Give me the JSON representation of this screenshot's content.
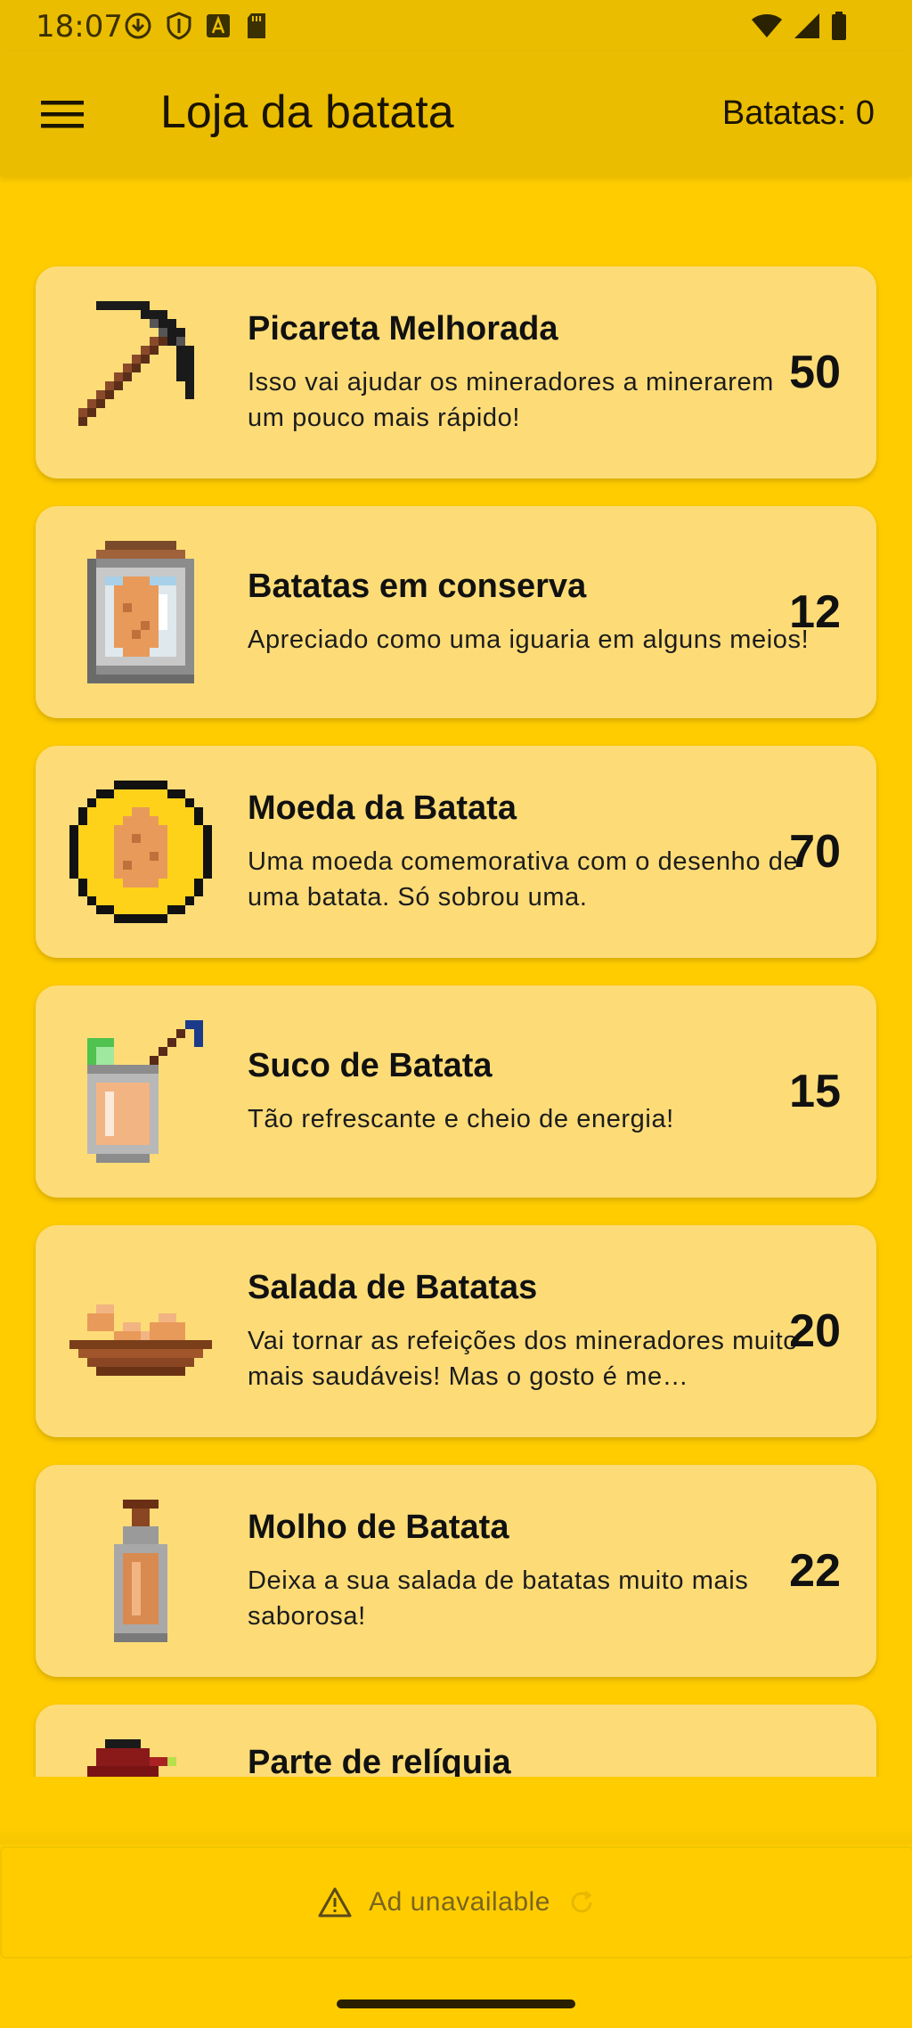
{
  "status_bar": {
    "time": "18:07",
    "left_icons": [
      "download-circle-icon",
      "shield-icon",
      "font-a-icon",
      "sd-card-icon"
    ],
    "right_icons": [
      "wifi-icon",
      "cellular-signal-icon",
      "battery-icon"
    ]
  },
  "app_bar": {
    "title": "Loja da batata",
    "menu_icon": "hamburger-menu-icon",
    "counter": "Batatas: 0"
  },
  "items": [
    {
      "icon": "pickaxe-icon",
      "title": "Picareta Melhorada",
      "description": "Isso vai ajudar os mineradores a minerarem um pouco mais rápido!",
      "price": "50"
    },
    {
      "icon": "potato-jar-icon",
      "title": "Batatas em conserva",
      "description": "Apreciado como uma iguaria em alguns meios!",
      "price": "12"
    },
    {
      "icon": "potato-coin-icon",
      "title": "Moeda da Batata",
      "description": "Uma moeda comemorativa com o desenho de uma batata. Só sobrou uma.",
      "price": "70"
    },
    {
      "icon": "potato-juice-icon",
      "title": "Suco de Batata",
      "description": "Tão refrescante e cheio de energia!",
      "price": "15"
    },
    {
      "icon": "potato-salad-icon",
      "title": "Salada de Batatas",
      "description": "Vai tornar as refeições dos mineradores muito mais saudáveis! Mas o gosto é me…",
      "price": "20"
    },
    {
      "icon": "potato-sauce-bottle-icon",
      "title": "Molho de Batata",
      "description": "Deixa a sua salada de batatas muito mais saborosa!",
      "price": "22"
    },
    {
      "icon": "relic-part-icon",
      "title": "Parte de relíquia",
      "description": "",
      "price": ""
    }
  ],
  "ad_banner": {
    "icon": "warning-icon",
    "text": "Ad unavailable",
    "reload_icon": "refresh-icon"
  },
  "colors": {
    "background": "#ffcc00",
    "app_bar": "#ebbd00",
    "card": "#fddc77",
    "text": "#111111"
  }
}
